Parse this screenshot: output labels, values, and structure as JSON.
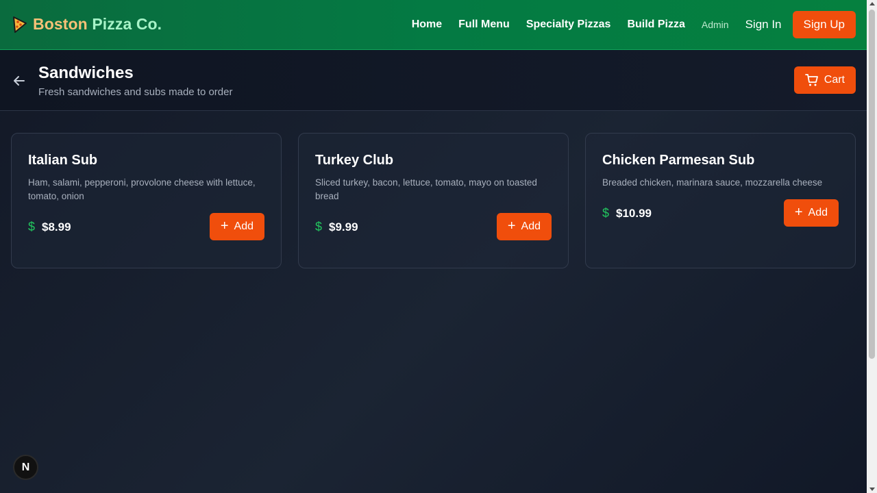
{
  "header": {
    "brand_part1": "Boston",
    "brand_part2": "Pizza Co.",
    "logo_icon": "pizza-slice-icon",
    "nav": {
      "home": "Home",
      "full_menu": "Full Menu",
      "specialty": "Specialty Pizzas",
      "build": "Build Pizza",
      "admin": "Admin",
      "sign_in": "Sign In",
      "sign_up": "Sign Up"
    }
  },
  "page": {
    "title": "Sandwiches",
    "subtitle": "Fresh sandwiches and subs made to order",
    "cart_label": "Cart",
    "back_icon": "arrow-left-icon",
    "cart_icon": "shopping-cart-icon"
  },
  "items": [
    {
      "name": "Italian Sub",
      "description": "Ham, salami, pepperoni, provolone cheese with lettuce, tomato, onion",
      "price": "$8.99",
      "add_label": "Add"
    },
    {
      "name": "Turkey Club",
      "description": "Sliced turkey, bacon, lettuce, tomato, mayo on toasted bread",
      "price": "$9.99",
      "add_label": "Add"
    },
    {
      "name": "Chicken Parmesan Sub",
      "description": "Breaded chicken, marinara sauce, mozzarella cheese",
      "price": "$10.99",
      "add_label": "Add"
    }
  ],
  "badge": {
    "letter": "N"
  },
  "colors": {
    "header_green": "#047a43",
    "accent_orange": "#f04e0c",
    "price_green": "#22c55e",
    "background": "#1b2433"
  }
}
